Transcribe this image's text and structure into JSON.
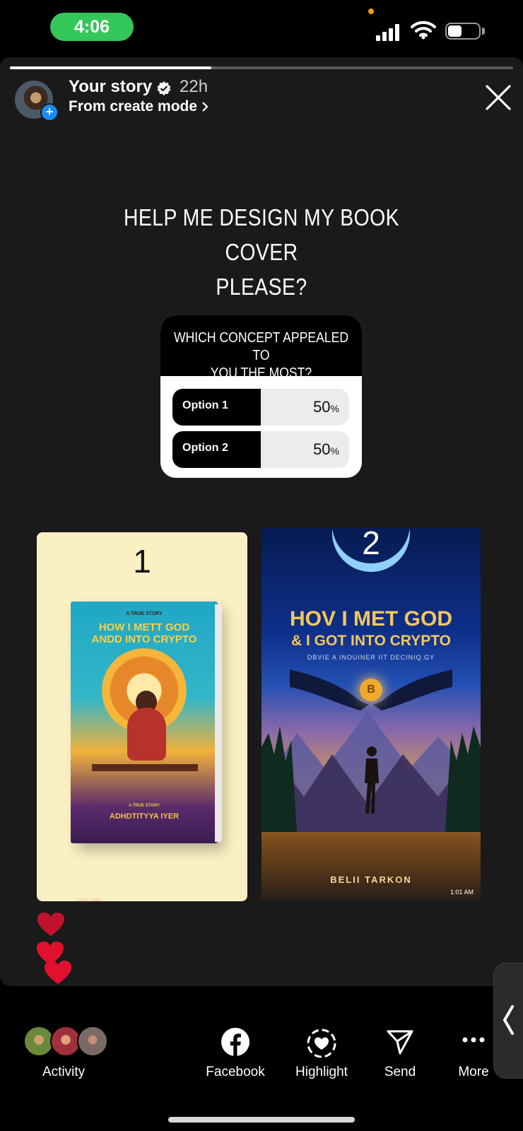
{
  "status_bar": {
    "time": "4:06",
    "battery_level": 0.45
  },
  "story": {
    "owner": "Your story",
    "age": "22h",
    "source": "From create mode",
    "progress": 0.4
  },
  "headline": {
    "line1": "HELP ME DESIGN MY BOOK COVER",
    "line2": "PLEASE?"
  },
  "poll": {
    "question_line1": "WHICH CONCEPT APPEALED TO",
    "question_line2": "YOU THE MOST?",
    "options": [
      {
        "label": "Option 1",
        "percent": 50,
        "display": "50"
      },
      {
        "label": "Option 2",
        "percent": 50,
        "display": "50"
      }
    ],
    "percent_sign": "%"
  },
  "covers": [
    {
      "number": "1",
      "kicker": "A TRUE STORY",
      "title_line1": "HOW I METT GOD",
      "title_line2": "ANDD INTO CRYPTO",
      "kicker2": "A TRUE STORY",
      "author": "ADHDTITYYA IYER"
    },
    {
      "number": "2",
      "title_line1": "HOV I MET GOD",
      "title_line2": "& I GOT INTO CRYPTO",
      "subtitle": "DBVIE A INOUINER IIT DECINIQ.GY",
      "coin_symbol": "B",
      "author": "BELII TARKON",
      "timestamp": "1:01 AM"
    }
  ],
  "colors": {
    "accent_green": "#34c759",
    "verified_blue": "#1b8cf2",
    "heart_red": "#e0102e",
    "heart_pink": "#f7a090"
  },
  "bottom_bar": {
    "activity_label": "Activity",
    "actions": [
      {
        "label": "Facebook",
        "icon": "facebook-icon"
      },
      {
        "label": "Highlight",
        "icon": "highlight-icon"
      },
      {
        "label": "Send",
        "icon": "send-icon"
      },
      {
        "label": "More",
        "icon": "more-icon"
      }
    ]
  }
}
